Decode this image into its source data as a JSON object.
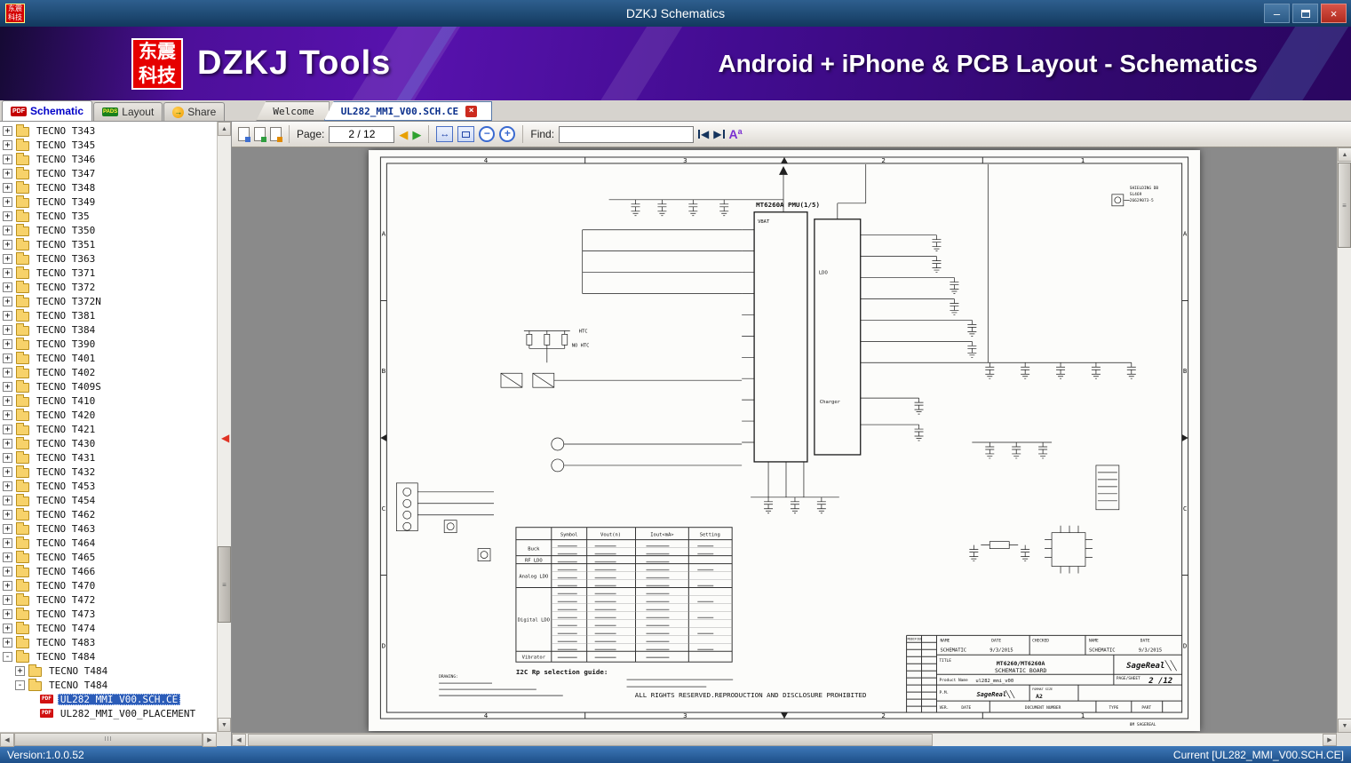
{
  "window": {
    "title": "DZKJ Schematics",
    "logo_text": "东震科技"
  },
  "banner": {
    "logo_text": "东震科技",
    "app_name": "DZKJ Tools",
    "tagline": "Android + iPhone & PCB Layout - Schematics"
  },
  "tabs": {
    "main": [
      {
        "label": "Schematic"
      },
      {
        "label": "Layout"
      },
      {
        "label": "Share"
      }
    ],
    "documents": [
      {
        "label": "Welcome"
      },
      {
        "label": "UL282_MMI_V00.SCH.CE"
      }
    ]
  },
  "sidebar": {
    "items": [
      {
        "label": "TECNO T343",
        "level": 0,
        "expander": "plus",
        "icon": "folder"
      },
      {
        "label": "TECNO T345",
        "level": 0,
        "expander": "plus",
        "icon": "folder"
      },
      {
        "label": "TECNO T346",
        "level": 0,
        "expander": "plus",
        "icon": "folder"
      },
      {
        "label": "TECNO T347",
        "level": 0,
        "expander": "plus",
        "icon": "folder"
      },
      {
        "label": "TECNO T348",
        "level": 0,
        "expander": "plus",
        "icon": "folder"
      },
      {
        "label": "TECNO T349",
        "level": 0,
        "expander": "plus",
        "icon": "folder"
      },
      {
        "label": "TECNO T35",
        "level": 0,
        "expander": "plus",
        "icon": "folder"
      },
      {
        "label": "TECNO T350",
        "level": 0,
        "expander": "plus",
        "icon": "folder"
      },
      {
        "label": "TECNO T351",
        "level": 0,
        "expander": "plus",
        "icon": "folder"
      },
      {
        "label": "TECNO T363",
        "level": 0,
        "expander": "plus",
        "icon": "folder"
      },
      {
        "label": "TECNO T371",
        "level": 0,
        "expander": "plus",
        "icon": "folder"
      },
      {
        "label": "TECNO T372",
        "level": 0,
        "expander": "plus",
        "icon": "folder"
      },
      {
        "label": "TECNO T372N",
        "level": 0,
        "expander": "plus",
        "icon": "folder"
      },
      {
        "label": "TECNO T381",
        "level": 0,
        "expander": "plus",
        "icon": "folder"
      },
      {
        "label": "TECNO T384",
        "level": 0,
        "expander": "plus",
        "icon": "folder"
      },
      {
        "label": "TECNO T390",
        "level": 0,
        "expander": "plus",
        "icon": "folder"
      },
      {
        "label": "TECNO T401",
        "level": 0,
        "expander": "plus",
        "icon": "folder"
      },
      {
        "label": "TECNO T402",
        "level": 0,
        "expander": "plus",
        "icon": "folder"
      },
      {
        "label": "TECNO T409S",
        "level": 0,
        "expander": "plus",
        "icon": "folder"
      },
      {
        "label": "TECNO T410",
        "level": 0,
        "expander": "plus",
        "icon": "folder"
      },
      {
        "label": "TECNO T420",
        "level": 0,
        "expander": "plus",
        "icon": "folder"
      },
      {
        "label": "TECNO T421",
        "level": 0,
        "expander": "plus",
        "icon": "folder"
      },
      {
        "label": "TECNO T430",
        "level": 0,
        "expander": "plus",
        "icon": "folder"
      },
      {
        "label": "TECNO T431",
        "level": 0,
        "expander": "plus",
        "icon": "folder"
      },
      {
        "label": "TECNO T432",
        "level": 0,
        "expander": "plus",
        "icon": "folder"
      },
      {
        "label": "TECNO T453",
        "level": 0,
        "expander": "plus",
        "icon": "folder"
      },
      {
        "label": "TECNO T454",
        "level": 0,
        "expander": "plus",
        "icon": "folder"
      },
      {
        "label": "TECNO T462",
        "level": 0,
        "expander": "plus",
        "icon": "folder"
      },
      {
        "label": "TECNO T463",
        "level": 0,
        "expander": "plus",
        "icon": "folder"
      },
      {
        "label": "TECNO T464",
        "level": 0,
        "expander": "plus",
        "icon": "folder"
      },
      {
        "label": "TECNO T465",
        "level": 0,
        "expander": "plus",
        "icon": "folder"
      },
      {
        "label": "TECNO T466",
        "level": 0,
        "expander": "plus",
        "icon": "folder"
      },
      {
        "label": "TECNO T470",
        "level": 0,
        "expander": "plus",
        "icon": "folder"
      },
      {
        "label": "TECNO T472",
        "level": 0,
        "expander": "plus",
        "icon": "folder"
      },
      {
        "label": "TECNO T473",
        "level": 0,
        "expander": "plus",
        "icon": "folder"
      },
      {
        "label": "TECNO T474",
        "level": 0,
        "expander": "plus",
        "icon": "folder"
      },
      {
        "label": "TECNO T483",
        "level": 0,
        "expander": "plus",
        "icon": "folder"
      },
      {
        "label": "TECNO T484",
        "level": 0,
        "expander": "minus",
        "icon": "folder"
      },
      {
        "label": "TECNO T484",
        "level": 1,
        "expander": "plus",
        "icon": "folder"
      },
      {
        "label": "TECNO T484",
        "level": 1,
        "expander": "minus",
        "icon": "folder"
      },
      {
        "label": "UL282_MMI_V00.SCH.CE",
        "level": 2,
        "expander": "none",
        "icon": "pdf",
        "selected": true
      },
      {
        "label": "UL282_MMI_V00_PLACEMENT",
        "level": 2,
        "expander": "none",
        "icon": "pdf"
      }
    ]
  },
  "toolbar": {
    "page_label": "Page:",
    "page_value": "2 / 12",
    "find_label": "Find:",
    "find_value": ""
  },
  "schematic": {
    "grid": {
      "cols": [
        "4",
        "3",
        "2",
        "1"
      ],
      "rows": [
        "A",
        "B",
        "C",
        "D"
      ]
    },
    "pmu_label": "MT6260A PMU(1/5)",
    "labels": {
      "vbat": "VBAT",
      "ldo": "LDO",
      "charger": "Charger",
      "htc": "HTC",
      "no_htc": "NO HTC"
    },
    "i2c_table": {
      "title": "I2C Rp selection guide:",
      "headers": [
        "Symbol",
        "Vout(n)",
        "Iout<mA>",
        "Setting"
      ],
      "groups": [
        "Buck",
        "RF LDO",
        "Analog LDO",
        "Digital LDO",
        "Vibrator"
      ]
    },
    "drawing_label": "DRAWING:",
    "rights_note": "ALL RIGHTS RESERVED.REPRODUCTION AND DISCLOSURE PROHIBITED",
    "shield_ref": [
      "SHIELDING DB",
      "SL469",
      "26629073-5"
    ],
    "title_block": {
      "modified_label": "MODIFIED",
      "name_label": "NAME",
      "schematic_value": "SCHEMATIC",
      "date_label": "DATE",
      "date_value": "9/3/2015",
      "checked_label": "CHECKED",
      "title_label": "TITLE",
      "title_line1": "MT6260/MT6260A",
      "title_line2": "SCHEMATIC BOARD",
      "product_label": "Product Name",
      "product_value": "ul282_mmi_v00",
      "page_label": "PAGE/SHEET",
      "page_value": "2 /12",
      "pm_label": "P.M.",
      "brand": "SageReal",
      "format_label": "FORMAT SIZE",
      "format_value": "A2",
      "doc_label": "DOCUMENT NUMBER",
      "type_label": "TYPE",
      "part_label": "PART",
      "ver_label": "VER.",
      "footer": "8M SAGEREAL"
    }
  },
  "status_bar": {
    "version": "Version:1.0.0.52",
    "current": "Current [UL282_MMI_V00.SCH.CE]"
  },
  "icons": {
    "minimize": "–",
    "close": "×",
    "doc_close": "×",
    "pdf_badge": "PDF",
    "pads_badge": "PADS",
    "share_arrow": "→",
    "prev_page": "◀",
    "next_page": "▶",
    "zoom_out": "−",
    "zoom_in": "+",
    "fit_width": "↔",
    "find_prev": "◀",
    "find_next": "▶",
    "font_big": "A",
    "font_small": "a",
    "up": "▲",
    "down": "▼",
    "left": "◀",
    "right": "▶",
    "grip": "≡",
    "hgrip": "III",
    "splitter": "◀"
  }
}
